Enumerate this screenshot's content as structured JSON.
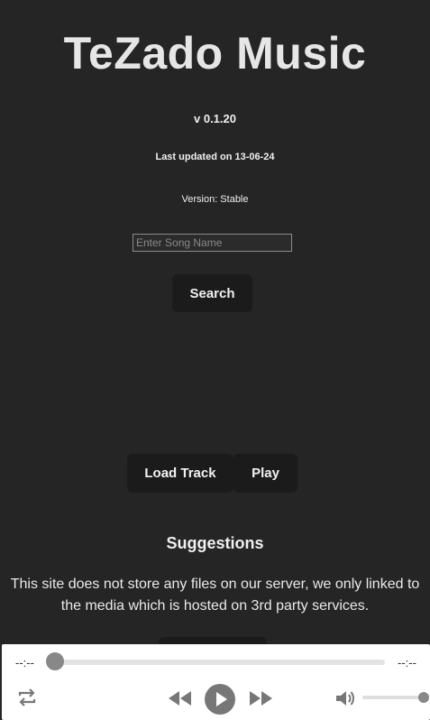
{
  "app": {
    "title": "TeZado Music",
    "version": "v 0.1.20",
    "last_updated": "Last updated on 13-06-24",
    "channel": "Version: Stable"
  },
  "search": {
    "placeholder": "Enter Song Name",
    "value": "",
    "button_label": "Search"
  },
  "controls": {
    "load_label": "Load Track",
    "play_label": "Play"
  },
  "suggestions": {
    "heading": "Suggestions",
    "disclaimer": "This site does not store any files on our server, we only linked to the media which is hosted on 3rd party services."
  },
  "player": {
    "current_time": "--:--",
    "duration": "--:--",
    "progress": 0,
    "volume": 1.0,
    "icons": {
      "repeat": "repeat-icon",
      "rewind": "rewind-icon",
      "play": "play-icon",
      "forward": "fast-forward-icon",
      "volume": "volume-icon"
    }
  },
  "colors": {
    "background": "#252525",
    "button": "#1b1b1b",
    "player_bg": "#ffffff",
    "player_icon": "#777777"
  }
}
